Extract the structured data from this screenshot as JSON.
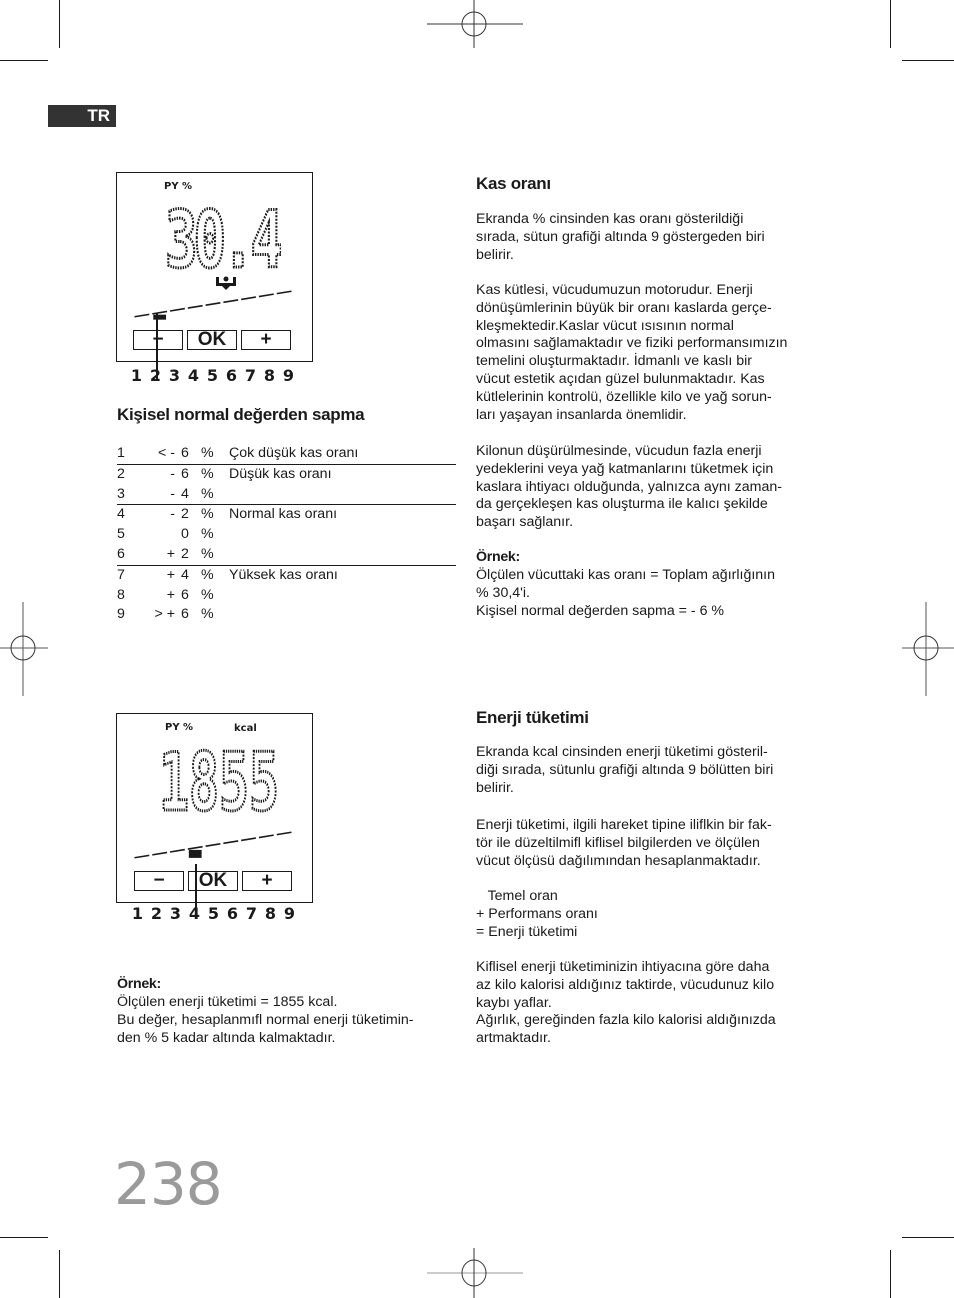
{
  "language_badge": "TR",
  "page_number": "238",
  "muscle_display": {
    "top_label": "PY %",
    "value": "30.4",
    "icon": "muscle-icon",
    "buttons": {
      "minus": "−",
      "ok": "OK",
      "plus": "+"
    },
    "scale": [
      "1",
      "2",
      "3",
      "4",
      "5",
      "6",
      "7",
      "8",
      "9"
    ],
    "selected_segment": 2
  },
  "deviation": {
    "title": "Kişisel normal değerden sapma",
    "rows": [
      {
        "n": "1",
        "sign": "< -",
        "value": "6",
        "unit": "%",
        "desc": "Çok düşük kas oranı"
      },
      {
        "n": "2",
        "sign": "-",
        "value": "6",
        "unit": "%",
        "desc": "Düşük kas oranı"
      },
      {
        "n": "3",
        "sign": "-",
        "value": "4",
        "unit": "%",
        "desc": ""
      },
      {
        "n": "4",
        "sign": "-",
        "value": "2",
        "unit": "%",
        "desc": "Normal kas oranı"
      },
      {
        "n": "5",
        "sign": "",
        "value": "0",
        "unit": "%",
        "desc": ""
      },
      {
        "n": "6",
        "sign": "+",
        "value": "2",
        "unit": "%",
        "desc": ""
      },
      {
        "n": "7",
        "sign": "+",
        "value": "4",
        "unit": "%",
        "desc": "Yüksek kas oranı"
      },
      {
        "n": "8",
        "sign": "+",
        "value": "6",
        "unit": "%",
        "desc": ""
      },
      {
        "n": "9",
        "sign": "> +",
        "value": "6",
        "unit": "%",
        "desc": ""
      }
    ]
  },
  "kas_orani": {
    "title": "Kas oranı",
    "p1": "Ekranda % cinsinden kas oranı gösterildiği\nsırada, sütun grafiği altında 9 göstergeden biri\nbelirir.",
    "p2": "Kas kütlesi, vücudumuzun motorudur. Enerji\ndönüşümlerinin büyük bir oranı kaslarda gerçe-\nkleşmektedir.Kaslar vücut ısısının normal\nolmasını sağlamaktadır ve fiziki performansımızın\ntemelini oluşturmaktadır. İdmanlı ve kaslı bir\nvücut estetik açıdan güzel bulunmaktadır. Kas\nkütlelerinin kontrolü, özellikle kilo ve yağ sorun-\nları yaşayan insanlarda önemlidir.",
    "p3": "Kilonun düşürülmesinde, vücudun fazla enerji\nyedeklerini veya yağ katmanlarını tüketmek için\nkaslara ihtiyacı olduğunda, yalnızca aynı zaman-\nda gerçekleşen kas oluşturma ile kalıcı şekilde\nbaşarı sağlanır.",
    "example_head": "Örnek:",
    "example_text": "Ölçülen vücuttaki kas oranı = Toplam ağırlığının\n% 30,4'i.\nKişisel normal değerden sapma = - 6 %"
  },
  "energy_display": {
    "top_label": "PY %",
    "unit_label": "kcal",
    "value": "1855",
    "buttons": {
      "minus": "−",
      "ok": "OK",
      "plus": "+"
    },
    "scale": [
      "1",
      "2",
      "3",
      "4",
      "5",
      "6",
      "7",
      "8",
      "9"
    ],
    "selected_segment": 4
  },
  "energy_example": {
    "head": "Örnek:",
    "text": "Ölçülen enerji tüketimi = 1855 kcal.\nBu değer, hesaplanmıfl normal enerji tüketimin-\nden % 5 kadar altında kalmaktadır."
  },
  "enerji": {
    "title": "Enerji tüketimi",
    "p1": "Ekranda kcal cinsinden enerji tüketimi gösteril-\ndiği sırada, sütunlu grafiği altında 9 bölütten biri\nbelirir.",
    "p2": "Enerji tüketimi, ilgili hareket tipine iliflkin bir fak-\ntör ile düzeltilmifl kiflisel bilgilerden ve ölçülen\nvücut ölçüsü dağılımından hesaplanmaktadır.",
    "formula": [
      "   Temel oran",
      "+ Performans oranı",
      "= Enerji tüketimi"
    ],
    "p3": "Kiflisel enerji tüketiminizin ihtiyacına göre daha\naz kilo kalorisi aldığınız taktirde, vücudunuz kilo\nkaybı yaflar.\nAğırlık, gereğinden fazla kilo kalorisi aldığınızda\nartmaktadır."
  }
}
